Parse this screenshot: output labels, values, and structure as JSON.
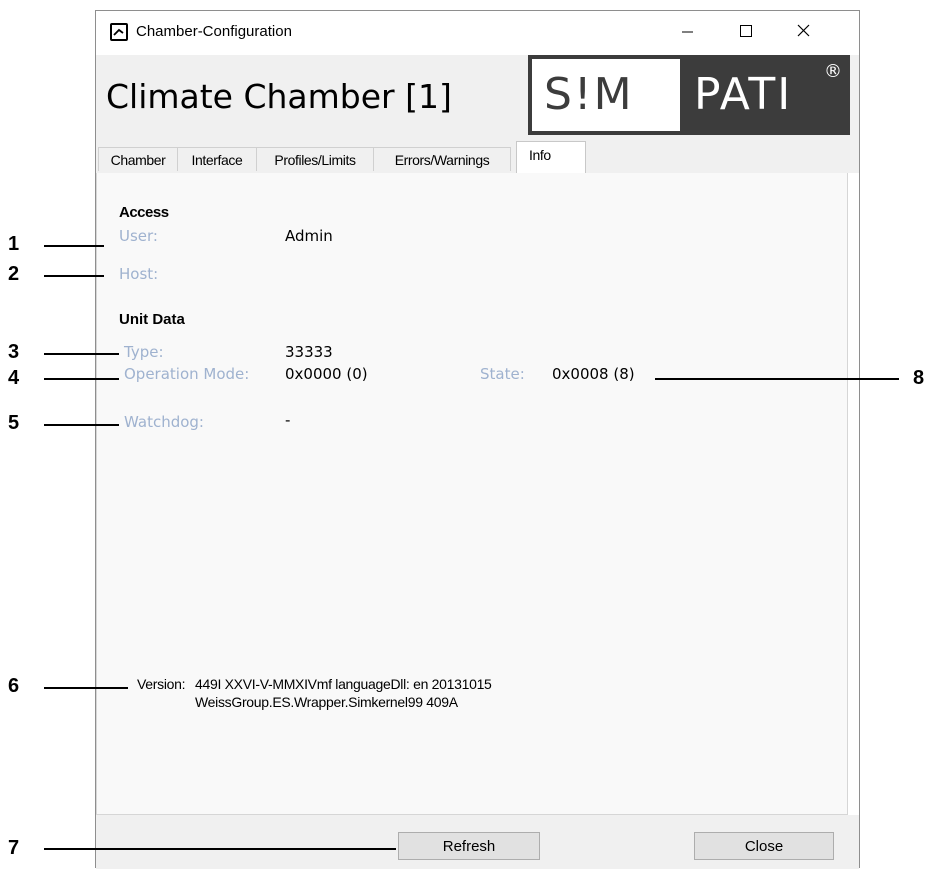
{
  "window": {
    "title": "Chamber-Configuration",
    "minimize_glyph": "─",
    "maximize_glyph": "☐",
    "close_glyph": "✕"
  },
  "header": {
    "app_title": "Climate Chamber [1]",
    "logo_left": "S!M",
    "logo_right": "PATI",
    "logo_mark": "®"
  },
  "tabs": [
    {
      "label": "Chamber",
      "active": false
    },
    {
      "label": "Interface",
      "active": false
    },
    {
      "label": "Profiles/Limits",
      "active": false
    },
    {
      "label": "Errors/Warnings",
      "active": false
    },
    {
      "label": "Info",
      "active": true
    }
  ],
  "access": {
    "title": "Access",
    "user_label": "User:",
    "user_value": "Admin",
    "host_label": "Host:",
    "host_value": ""
  },
  "unit_data": {
    "title": "Unit Data",
    "type_label": "Type:",
    "type_value": "33333",
    "op_mode_label": "Operation Mode:",
    "op_mode_value": "0x0000 (0)",
    "state_label": "State:",
    "state_value": "0x0008 (8)",
    "watchdog_label": "Watchdog:",
    "watchdog_value": "-"
  },
  "version": {
    "label": "Version:",
    "line1": "449I XXVI-V-MMXIVmf languageDll: en 20131015",
    "line2": "WeissGroup.ES.Wrapper.Simkernel99 409A"
  },
  "footer": {
    "refresh_label": "Refresh",
    "close_label": "Close"
  },
  "callouts": [
    "1",
    "2",
    "3",
    "4",
    "5",
    "6",
    "7",
    "8"
  ],
  "colors": {
    "field_label": "#9fb2cf",
    "logo_dark": "#3c3c3c",
    "panel_bg": "#f9f9f9",
    "chrome_bg": "#f0f0f0"
  }
}
